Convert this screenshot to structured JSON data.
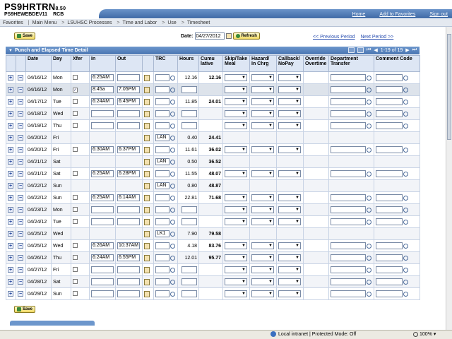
{
  "header": {
    "system": "PS9HRTRN",
    "version": "8.50",
    "database": "PS9HEWEBDEV11",
    "user": "RCB",
    "links": [
      "Home",
      "Add to Favorites",
      "Sign out"
    ]
  },
  "breadcrumb": [
    "Favorites",
    "Main Menu",
    "LSUHSC Processes",
    "Time and Labor",
    "Use",
    "Timesheet"
  ],
  "toolbar": {
    "save_label": "Save",
    "date_label": "Date:",
    "date_value": "04/27/2012",
    "refresh_label": "Refresh",
    "prev_period": "<< Previous Period",
    "next_period": "Next Period >>"
  },
  "grid": {
    "title": "Punch and Elapsed Time Detail",
    "pager": "1-19 of 19",
    "columns": [
      "",
      "",
      "Date",
      "Day",
      "Xfer",
      "In",
      "Out",
      "",
      "TRC",
      "Hours",
      "Cumu lative",
      "Skip/Take Meal",
      "Hazard/ In Chrg",
      "Callback/ NoPay",
      "Override Overtime",
      "Department Transfer",
      "Comment Code"
    ],
    "rows": [
      {
        "date": "04/16/12",
        "day": "Mon",
        "xfer": true,
        "xfer_checked": false,
        "in": "6:25AM",
        "out": "",
        "punch": true,
        "trc": "",
        "hours": "12.16",
        "cumulative": "12.16",
        "inputs": true
      },
      {
        "date": "04/16/12",
        "day": "Mon",
        "xfer": true,
        "xfer_checked": true,
        "in": "8:45a",
        "out": "7:05PM",
        "punch": true,
        "trc": "",
        "hours": "",
        "cumulative": "",
        "inputs": true,
        "selected": true
      },
      {
        "date": "04/17/12",
        "day": "Tue",
        "xfer": true,
        "xfer_checked": false,
        "in": "6:24AM",
        "out": "6:45PM",
        "punch": true,
        "trc": "",
        "hours": "11.85",
        "cumulative": "24.01",
        "inputs": true
      },
      {
        "date": "04/18/12",
        "day": "Wed",
        "xfer": true,
        "xfer_checked": false,
        "in": "",
        "out": "",
        "punch": true,
        "trc": "",
        "hours": "",
        "cumulative": "",
        "inputs": true
      },
      {
        "date": "04/19/12",
        "day": "Thu",
        "xfer": true,
        "xfer_checked": false,
        "in": "",
        "out": "",
        "punch": true,
        "trc": "",
        "hours": "",
        "cumulative": "",
        "inputs": true
      },
      {
        "date": "04/20/12",
        "day": "Fri",
        "xfer": false,
        "xfer_checked": false,
        "in": "",
        "out": "",
        "punch": false,
        "trc": "LAN",
        "hours": "0.40",
        "cumulative": "24.41",
        "inputs": false
      },
      {
        "date": "04/20/12",
        "day": "Fri",
        "xfer": true,
        "xfer_checked": false,
        "in": "6:30AM",
        "out": "6:37PM",
        "punch": true,
        "trc": "",
        "hours": "11.61",
        "cumulative": "36.02",
        "inputs": true
      },
      {
        "date": "04/21/12",
        "day": "Sat",
        "xfer": false,
        "xfer_checked": false,
        "in": "",
        "out": "",
        "punch": false,
        "trc": "LAN",
        "hours": "0.50",
        "cumulative": "36.52",
        "inputs": false
      },
      {
        "date": "04/21/12",
        "day": "Sat",
        "xfer": true,
        "xfer_checked": false,
        "in": "6:25AM",
        "out": "6:28PM",
        "punch": true,
        "trc": "",
        "hours": "11.55",
        "cumulative": "48.07",
        "inputs": true
      },
      {
        "date": "04/22/12",
        "day": "Sun",
        "xfer": false,
        "xfer_checked": false,
        "in": "",
        "out": "",
        "punch": false,
        "trc": "LAN",
        "hours": "0.80",
        "cumulative": "48.87",
        "inputs": false
      },
      {
        "date": "04/22/12",
        "day": "Sun",
        "xfer": true,
        "xfer_checked": false,
        "in": "6:25AM",
        "out": "6:14AM",
        "punch": true,
        "trc": "",
        "hours": "22.81",
        "cumulative": "71.68",
        "inputs": true
      },
      {
        "date": "04/23/12",
        "day": "Mon",
        "xfer": true,
        "xfer_checked": false,
        "in": "",
        "out": "",
        "punch": true,
        "trc": "",
        "hours": "",
        "cumulative": "",
        "inputs": true
      },
      {
        "date": "04/24/12",
        "day": "Tue",
        "xfer": true,
        "xfer_checked": false,
        "in": "",
        "out": "",
        "punch": true,
        "trc": "",
        "hours": "",
        "cumulative": "",
        "inputs": true
      },
      {
        "date": "04/25/12",
        "day": "Wed",
        "xfer": false,
        "xfer_checked": false,
        "in": "",
        "out": "",
        "punch": false,
        "trc": "LK1",
        "hours": "7.90",
        "cumulative": "79.58",
        "inputs": false
      },
      {
        "date": "04/25/12",
        "day": "Wed",
        "xfer": true,
        "xfer_checked": false,
        "in": "6:26AM",
        "out": "10:37AM",
        "punch": true,
        "trc": "",
        "hours": "4.18",
        "cumulative": "83.76",
        "inputs": true
      },
      {
        "date": "04/26/12",
        "day": "Thu",
        "xfer": true,
        "xfer_checked": false,
        "in": "6:24AM",
        "out": "6:55PM",
        "punch": true,
        "trc": "",
        "hours": "12.01",
        "cumulative": "95.77",
        "inputs": true
      },
      {
        "date": "04/27/12",
        "day": "Fri",
        "xfer": true,
        "xfer_checked": false,
        "in": "",
        "out": "",
        "punch": true,
        "trc": "",
        "hours": "",
        "cumulative": "",
        "inputs": true
      },
      {
        "date": "04/28/12",
        "day": "Sat",
        "xfer": true,
        "xfer_checked": false,
        "in": "",
        "out": "",
        "punch": true,
        "trc": "",
        "hours": "",
        "cumulative": "",
        "inputs": true
      },
      {
        "date": "04/29/12",
        "day": "Sun",
        "xfer": true,
        "xfer_checked": false,
        "in": "",
        "out": "",
        "punch": true,
        "trc": "",
        "hours": "",
        "cumulative": "",
        "inputs": true
      }
    ]
  },
  "statusbar": {
    "zone": "Local intranet | Protected Mode: Off",
    "zoom": "100%"
  }
}
